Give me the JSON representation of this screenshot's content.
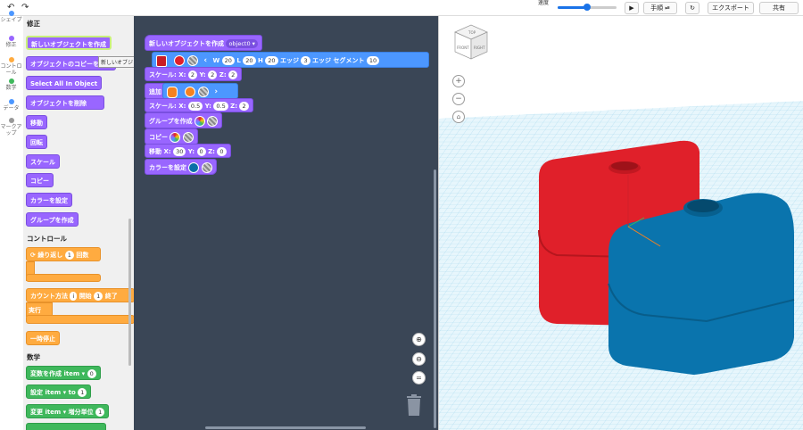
{
  "topbar": {
    "undo_icon": "undo-icon",
    "redo_icon": "redo-icon",
    "speed_label": "速度",
    "speed_value": 0.5,
    "play_icon": "play-icon",
    "step_label": "手順",
    "reset_icon": "reset-icon",
    "export_label": "エクスポート",
    "share_label": "共有"
  },
  "categories": [
    {
      "label": "シェイプ",
      "color": "#4c97ff"
    },
    {
      "label": "修正",
      "color": "#9966ff"
    },
    {
      "label": "コントロール",
      "color": "#ffab40"
    },
    {
      "label": "数学",
      "color": "#3fb85c"
    },
    {
      "label": "データ",
      "color": "#4c97ff"
    },
    {
      "label": "マークアップ",
      "color": "#999999"
    }
  ],
  "palette": {
    "heading_modify": "修正",
    "create_object": "新しいオブジェクトを作成",
    "copy_object": "オブジェクトのコピーを追加",
    "select_all": "Select All In Object",
    "delete_object": "オブジェクトを削除",
    "move": "移動",
    "rotate": "回転",
    "scale": "スケール",
    "copy": "コピー",
    "set_color": "カラーを設定",
    "group": "グループを作成",
    "heading_control": "コントロール",
    "repeat": "繰り返し",
    "repeat_count": "1",
    "repeat_unit": "回数",
    "count_with": "カウント方法",
    "count_var": "i",
    "count_start": "開始",
    "count_start_val": "1",
    "count_end": "終了",
    "count_do": "実行",
    "pause": "一時停止",
    "heading_math": "数学",
    "create_var": "変数を作成",
    "create_var_name": "item",
    "create_var_val": "0",
    "set": "設定",
    "set_name": "item",
    "set_to": "to",
    "set_val": "1",
    "change": "変更",
    "change_name": "item",
    "change_by": "増分単位",
    "change_val": "1",
    "tooltip": "新しいオブジェクトを作成"
  },
  "workspace": {
    "create_object": "新しいオブジェクトを作成",
    "object_name": "object0",
    "shape_w_label": "W",
    "shape_w": "20",
    "shape_l_label": "L",
    "shape_l": "20",
    "shape_h_label": "H",
    "shape_h": "20",
    "edge_label": "エッジ",
    "edge": "3",
    "edge_seg_label": "エッジ セグメント",
    "edge_seg": "10",
    "scale1": "スケール:",
    "scale1_x": "2",
    "scale1_y": "2",
    "scale1_z": "2",
    "add": "追加",
    "scale2": "スケール:",
    "scale2_x": "0.5",
    "scale2_y": "0.5",
    "scale2_z": "2",
    "group": "グループを作成",
    "copy": "コピー",
    "move": "移動",
    "move_x": "30",
    "move_y": "0",
    "move_z": "0",
    "set_color": "カラーを設定",
    "x_label": "X:",
    "y_label": "Y:",
    "z_label": "Z:",
    "colors": {
      "red": "#e0202a",
      "orange": "#f58220",
      "blue": "#0a6fa8"
    }
  },
  "viewport": {
    "viewcube_front": "FRONT",
    "viewcube_top": "TOP",
    "viewcube_right": "RIGHT",
    "grid_color": "#bde4f4",
    "red_box_color": "#e0202a",
    "blue_box_color": "#0a74ad"
  }
}
